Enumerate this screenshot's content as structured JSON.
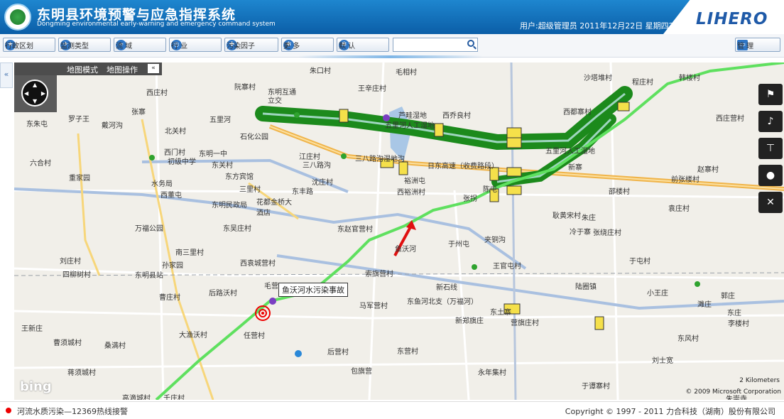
{
  "header": {
    "title_cn": "东明县环境预警与应急指挥系统",
    "title_en": "Dongming environmental early-warning and emergency command system",
    "user_info": "用户:超级管理员  2011年12月22日  星期四21:17",
    "brand": "LIHERO"
  },
  "toolbar": {
    "buttons": [
      {
        "label": "行政区划",
        "icon": "star-icon"
      },
      {
        "label": "监测类型",
        "icon": "bird-icon"
      },
      {
        "label": "流  域",
        "icon": "wave-icon"
      },
      {
        "label": "行  业",
        "icon": "target-icon"
      },
      {
        "label": "污染因子",
        "icon": "puzzle-icon"
      },
      {
        "label": "更  多",
        "icon": "gear-icon"
      },
      {
        "label": "默  认",
        "icon": "gear-icon"
      }
    ],
    "search_value": "",
    "manage_label": "管  理"
  },
  "map": {
    "panel_mode": "地图模式",
    "panel_ops": "地图操作",
    "callout": "鱼沃河水污染事故",
    "scale": "2 Kilometers",
    "copyright": "© 2009 Microsoft Corporation",
    "logo": "bing",
    "labels": [
      "朱口村",
      "毛相村",
      "沙塔堆村",
      "程庄村",
      "韩楼村",
      "阮寨村",
      "东明互通",
      "立交",
      "王辛庄村",
      "西庄村",
      "罗子王",
      "张寨",
      "五里河",
      "芦畦湿地",
      "五里河人工湿地",
      "西乔良村",
      "西都寨村",
      "西庄营村",
      "东朱屯",
      "戴河沟",
      "北关村",
      "石化公园",
      "东明一中",
      "江庄村",
      "三八路沟",
      "三八路沟湿地沟",
      "沙窝",
      "西门村",
      "初级中学",
      "东关村",
      "六合村",
      "重家园",
      "东方宾馆",
      "沈庄村",
      "裕洲屯",
      "西裕洲村",
      "水务局",
      "三里村",
      "东丰路",
      "东明民政局",
      "花都金桥大酒店",
      "西董屯",
      "日东高速（收费路段）",
      "五里河人工湿地",
      "张拐",
      "陈屯",
      "新寨",
      "赵寨村",
      "前张楼村",
      "邵楼村",
      "袁庄村",
      "耿黄宋村",
      "朱庄",
      "万福公园",
      "东吴庄村",
      "东赵官营村",
      "冷于寨",
      "张绕庄村",
      "南三里村",
      "于州屯",
      "夹铜沟",
      "于屯村",
      "刘庄村",
      "西袁城营村",
      "孙家园",
      "四柳树村",
      "东明县站",
      "鱼沃河",
      "王官屯村",
      "索旗营村",
      "陆圈镇",
      "新石线",
      "小王庄",
      "濉庄",
      "毛营",
      "后路沃村",
      "曹庄村",
      "马军营村",
      "东鱼河北支（万福河）",
      "东土寨",
      "郭庄",
      "东庄",
      "李楼村",
      "王新庄",
      "大渔沃村",
      "新郑旗庄",
      "营旗庄村",
      "曹须城村",
      "桑満村",
      "任营村",
      "后营村",
      "东营村",
      "东风村",
      "刘士宽",
      "蒋须城村",
      "包旗营",
      "永年集村",
      "高滴城村",
      "千庄村",
      "于谭寨村",
      "朱崇寺"
    ]
  },
  "footer": {
    "alert": "河流水质污染—12369热线接警",
    "copyright": "Copyright © 1997 - 2011 力合科技（湖南）股份有限公司"
  },
  "colors": {
    "header_blue": "#0b5ea7",
    "highlight_green": "#1a8a1a",
    "river_green": "#5fe05f",
    "road_orange": "#f0b44a",
    "alert_red": "#e00000"
  }
}
